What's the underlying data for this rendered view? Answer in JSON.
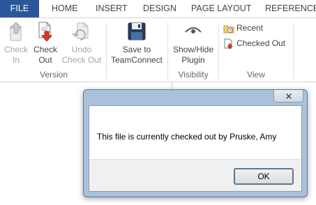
{
  "ribbon": {
    "tabs": [
      "FILE",
      "HOME",
      "INSERT",
      "DESIGN",
      "PAGE LAYOUT",
      "REFERENCES"
    ],
    "groups": {
      "version": {
        "label": "Version",
        "check_in": [
          "Check",
          "In"
        ],
        "check_out": [
          "Check",
          "Out"
        ],
        "undo_check_out": [
          "Undo",
          "Check Out"
        ]
      },
      "save": {
        "save_to": [
          "Save to",
          "TeamConnect"
        ]
      },
      "visibility": {
        "label": "Visibility",
        "show_hide": [
          "Show/Hide",
          "Plugin"
        ]
      },
      "view": {
        "label": "View",
        "recent": "Recent",
        "checked_out": "Checked Out"
      }
    }
  },
  "dialog": {
    "message": "This file is currently checked out by Pruske, Amy",
    "ok_label": "OK"
  },
  "colors": {
    "file_tab": "#2b579a",
    "dialog_frame": "#aac1dc"
  }
}
